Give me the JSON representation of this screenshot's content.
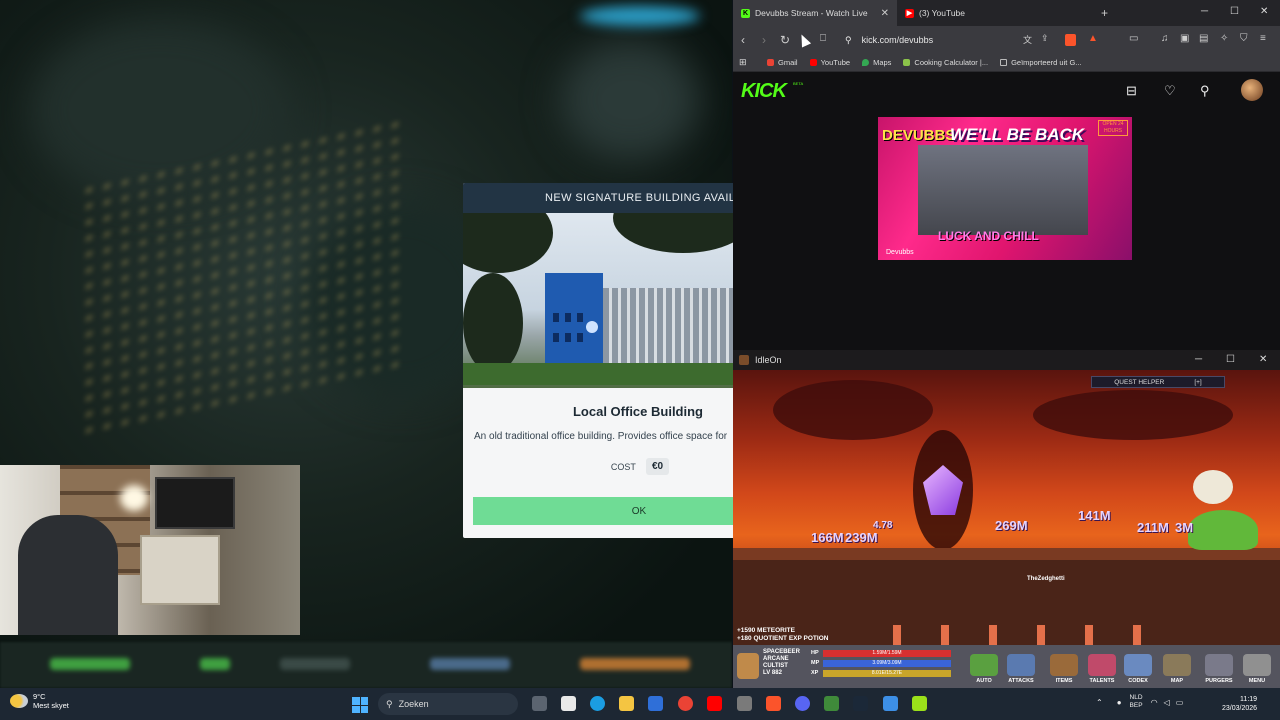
{
  "game": {
    "modal": {
      "header": "NEW SIGNATURE BUILDING AVAILABL",
      "building_name": "Local Office Building",
      "description": "An old traditional office building. Provides office space for",
      "cost_label": "COST",
      "cost_value": "€0",
      "ok_label": "OK"
    }
  },
  "browser": {
    "tabs": [
      {
        "label": "Devubbs Stream - Watch Live",
        "favicon": "kick-icon",
        "color": "#53fc18",
        "active": true
      },
      {
        "label": "(3) YouTube",
        "favicon": "youtube-icon",
        "color": "#ff0000",
        "active": false
      }
    ],
    "new_tab": "+",
    "url": "kick.com/devubbs",
    "bookmarks": [
      {
        "label": "Gmail",
        "icon": "gmail-icon",
        "color": "#ea4335"
      },
      {
        "label": "YouTube",
        "icon": "youtube-icon",
        "color": "#ff0000"
      },
      {
        "label": "Maps",
        "icon": "maps-icon",
        "color": "#34a853"
      },
      {
        "label": "Cooking Calculator |...",
        "icon": "leaf-icon",
        "color": "#8bc34a"
      },
      {
        "label": "Geïmporteerd uit G...",
        "icon": "folder-icon",
        "color": "#bbbbbb"
      }
    ],
    "kick": {
      "logo": "KICK",
      "beta": "BETA",
      "stream": {
        "brand": "DEVUBBS",
        "headline": "WE'LL BE BACK",
        "sub": "LUCK AND CHILL",
        "channel": "Devubbs",
        "badge": "OPEN 24 HOURS"
      }
    }
  },
  "idleon": {
    "window_title": "IdleOn",
    "quest_helper": "QUEST HELPER",
    "quest_helper_toggle": "[+]",
    "damage_numbers": [
      "166M",
      "239M",
      "4.78",
      "269M",
      "141M",
      "211M",
      "3M"
    ],
    "player_tag": "TheZedghetti",
    "feed": [
      "+1590 METEORITE",
      "+180 QUOTIENT EXP POTION"
    ],
    "character": {
      "line1": "SPACEBEER",
      "line2": "ARCANE",
      "line3": "CULTIST",
      "line4": "LV 882"
    },
    "bars": [
      {
        "label": "HP",
        "value": "1.59M/1.59M",
        "color": "#d83030"
      },
      {
        "label": "MP",
        "value": "3.09M/3.09M",
        "color": "#3a64d8"
      },
      {
        "label": "XP",
        "value": "8.01E/15.27E",
        "color": "#c9a52a"
      }
    ],
    "buttons": [
      {
        "label": "AUTO",
        "color": "#5aa040"
      },
      {
        "label": "ATTACKS",
        "color": "#5a7ab0"
      },
      {
        "label": "ITEMS",
        "color": "#9a6a3a"
      },
      {
        "label": "TALENTS",
        "color": "#c04a6a"
      },
      {
        "label": "CODEX",
        "color": "#6a8ac0"
      },
      {
        "label": "MAP",
        "color": "#8a7a5a"
      },
      {
        "label": "PURGERS",
        "color": "#7a7a8a"
      },
      {
        "label": "MENU",
        "color": "#909090"
      }
    ]
  },
  "taskbar": {
    "weather_temp": "9°C",
    "weather_desc": "Mest skyet",
    "search_placeholder": "Zoeken",
    "lang_line1": "NLD",
    "lang_line2": "BEP",
    "time": "11:19",
    "date": "23/03/2026"
  }
}
